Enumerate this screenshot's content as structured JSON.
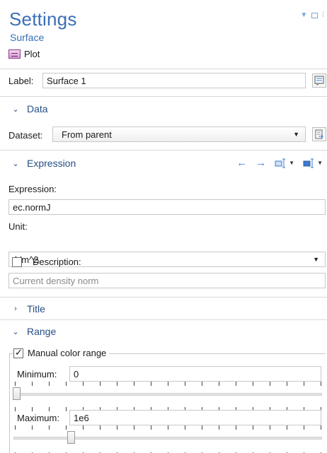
{
  "header": {
    "title": "Settings",
    "subtitle": "Surface",
    "plot_label": "Plot"
  },
  "label_row": {
    "label": "Label:",
    "value": "Surface 1"
  },
  "data_section": {
    "title": "Data",
    "dataset_label": "Dataset:",
    "dataset_value": "From parent"
  },
  "expression_section": {
    "title": "Expression",
    "expression_label": "Expression:",
    "expression_value": "ec.normJ",
    "unit_label": "Unit:",
    "unit_value": "A/m^2",
    "description_label": "Description:",
    "description_checked": false,
    "description_value": "Current density norm"
  },
  "title_section": {
    "title": "Title"
  },
  "range_section": {
    "title": "Range",
    "manual_color_label": "Manual color range",
    "manual_color_checked": true,
    "minimum_label": "Minimum:",
    "minimum_value": "0",
    "maximum_label": "Maximum:",
    "maximum_value": "1e6"
  },
  "icons": {
    "collapse": "chevron-down-icon",
    "expand": "chevron-right-icon",
    "arrow_left": "arrow-left-icon",
    "arrow_right": "arrow-right-icon"
  },
  "colors": {
    "accent": "#3a6fb7",
    "section_head": "#274f86",
    "toolbar_icon": "#3d7bd0"
  }
}
